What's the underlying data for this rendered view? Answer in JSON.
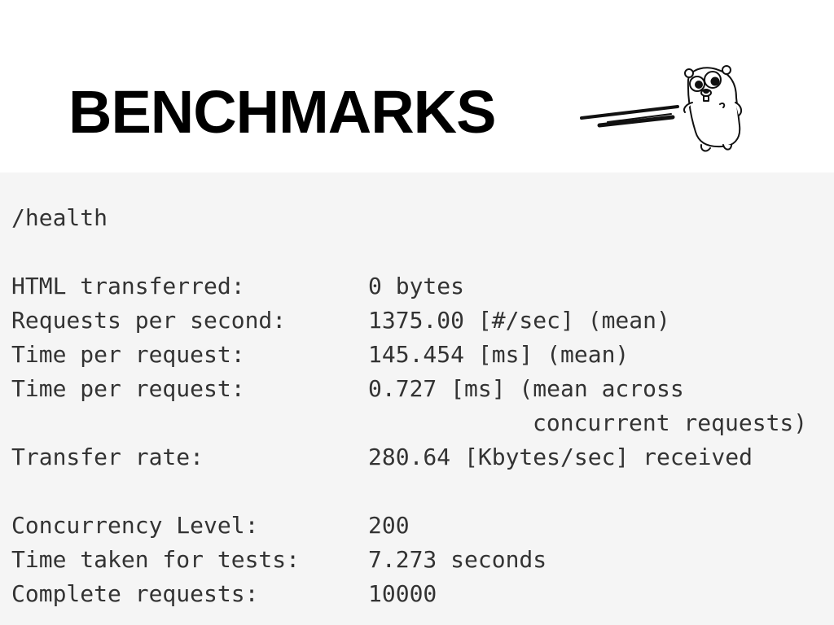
{
  "title": "BENCHMARKS",
  "colors": {
    "panel_background": "#f5f5f5",
    "code_text": "#333333",
    "title_text": "#000000"
  },
  "illustration": "gopher-mascot-running",
  "benchmark": {
    "endpoint": "/health",
    "group1": [
      {
        "label": "HTML transferred:",
        "value": "0 bytes"
      },
      {
        "label": "Requests per second:",
        "value": "1375.00 [#/sec] (mean)"
      },
      {
        "label": "Time per request:",
        "value": "145.454 [ms] (mean)"
      },
      {
        "label": "Time per request:",
        "value": "0.727 [ms] (mean across",
        "continuation": "concurrent requests)"
      },
      {
        "label": "Transfer rate:",
        "value": "280.64 [Kbytes/sec] received"
      }
    ],
    "group2": [
      {
        "label": "Concurrency Level:",
        "value": "200"
      },
      {
        "label": "Time taken for tests:",
        "value": "7.273 seconds"
      },
      {
        "label": "Complete requests:",
        "value": "10000"
      }
    ]
  }
}
